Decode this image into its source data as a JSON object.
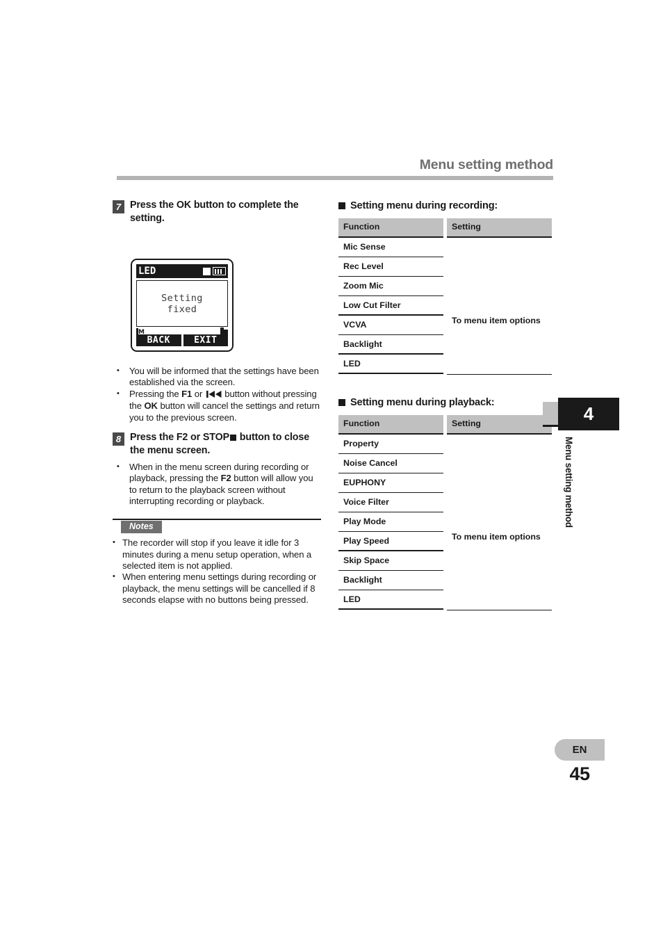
{
  "header": {
    "title": "Menu setting method"
  },
  "steps": [
    {
      "number": "7",
      "text_before": "Press the ",
      "bold_token": "OK",
      "text_after": " button to complete the setting."
    },
    {
      "number": "8",
      "text_before": "Press the ",
      "bold_token": "F2",
      "mid": " or ",
      "bold_token2": "STOP",
      "text_after": " button to close the menu screen."
    }
  ],
  "lcd": {
    "status_label": "LED",
    "card_icon": "card-icon",
    "battery_icon": "battery-icon",
    "screen_line1": "Setting",
    "screen_line2": "fixed",
    "mic_indicator": "M",
    "folder_icon": "folder-icon",
    "softkey_left": "BACK",
    "softkey_right": "EXIT"
  },
  "step7_bullets": [
    "You will be informed that the settings have been established via the screen.",
    "Pressing the F1 or ◀◀ button without pressing the OK button will cancel the settings and return you to the previous screen."
  ],
  "step8_bullets": [
    "When in the menu screen during recording or playback, pressing the F2 button will allow you to return to the playback screen without interrupting recording or playback."
  ],
  "notes": {
    "label": "Notes",
    "items": [
      "The recorder will stop if you leave it idle for 3 minutes during a menu setup operation, when a selected item is not applied.",
      "When entering menu settings during recording or playback, the menu settings will be cancelled if 8 seconds elapse with no buttons being pressed."
    ]
  },
  "tables": [
    {
      "heading": "Setting menu during recording:",
      "col_function": "Function",
      "col_setting": "Setting",
      "setting_value": "To menu item options",
      "rows": [
        "Mic Sense",
        "Rec Level",
        "Zoom Mic",
        "Low Cut Filter",
        "VCVA",
        "Backlight",
        "LED"
      ]
    },
    {
      "heading": "Setting menu during playback:",
      "col_function": "Function",
      "col_setting": "Setting",
      "setting_value": "To menu item options",
      "rows": [
        "Property",
        "Noise Cancel",
        "EUPHONY",
        "Voice Filter",
        "Play Mode",
        "Play Speed",
        "Skip Space",
        "Backlight",
        "LED"
      ]
    }
  ],
  "chapter": {
    "number": "4",
    "vertical_title": "Menu setting method"
  },
  "footer": {
    "language": "EN",
    "page": "45"
  },
  "colors": {
    "header_title": "#6f6f6f",
    "header_rule": "#b3b3b3",
    "table_header_fill": "#c0c0c0",
    "rule_black": "#1a1a1a",
    "step_badge": "#4a4a4a",
    "notes_tag": "#6f6f6f"
  }
}
